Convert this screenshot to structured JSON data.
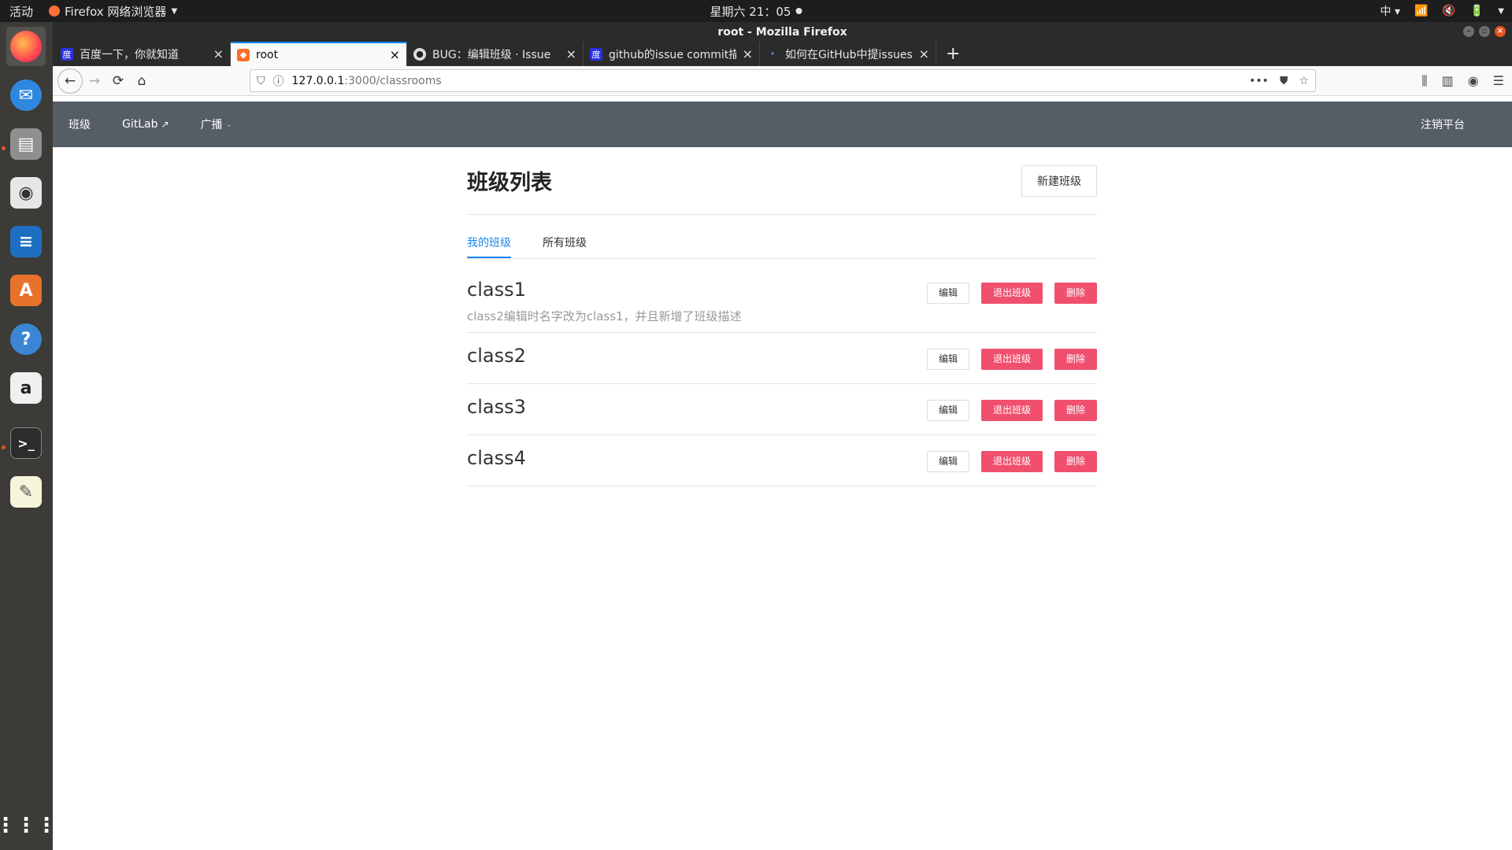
{
  "system": {
    "activities": "活动",
    "app_menu": "Firefox 网络浏览器",
    "clock": "星期六 21：05",
    "input_method": "中"
  },
  "window": {
    "title": "root - Mozilla Firefox"
  },
  "tabs": [
    {
      "label": "百度一下，你就知道",
      "active": false
    },
    {
      "label": "root",
      "active": true
    },
    {
      "label": "BUG：编辑班级 · Issue",
      "active": false
    },
    {
      "label": "github的issue commit描",
      "active": false
    },
    {
      "label": "如何在GitHub中提issues",
      "active": false
    }
  ],
  "urlbar": {
    "host": "127.0.0.1",
    "path": ":3000/classrooms"
  },
  "app": {
    "nav": {
      "classes": "班级",
      "gitlab": "GitLab",
      "broadcast": "广播",
      "logout": "注销平台"
    },
    "title": "班级列表",
    "new_class_label": "新建班级",
    "tabs": {
      "mine": "我的班级",
      "all": "所有班级"
    },
    "actions": {
      "edit": "编辑",
      "leave": "退出班级",
      "delete": "删除"
    },
    "classes": [
      {
        "name": "class1",
        "description": "class2编辑时名字改为class1，并且新增了班级描述"
      },
      {
        "name": "class2",
        "description": ""
      },
      {
        "name": "class3",
        "description": ""
      },
      {
        "name": "class4",
        "description": ""
      }
    ]
  },
  "colors": {
    "danger": "#f0506e",
    "primary": "#1e87f0",
    "navbar": "#555d67",
    "ubuntu_orange": "#e95420"
  }
}
